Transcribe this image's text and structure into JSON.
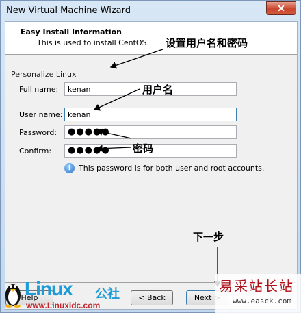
{
  "window": {
    "title": "New Virtual Machine Wizard",
    "close_glyph": "✕"
  },
  "header": {
    "title": "Easy Install Information",
    "subtitle": "This is used to install CentOS."
  },
  "group": {
    "label": "Personalize Linux"
  },
  "fields": {
    "full_name": {
      "label": "Full name:",
      "value": "kenan"
    },
    "user_name": {
      "label": "User name:",
      "value": "kenan"
    },
    "password": {
      "label": "Password:",
      "value": "●●●●●"
    },
    "confirm": {
      "label": "Confirm:",
      "value": "●●●●●"
    }
  },
  "info": {
    "icon": "info-icon",
    "text": "This password is for both user and root accounts."
  },
  "buttons": {
    "help": "Help",
    "back": "< Back",
    "next": "Next >"
  },
  "annotations": {
    "set_user_pw": "设置用户名和密码",
    "username": "用户名",
    "password": "密码",
    "next_step": "下一步"
  },
  "logo": {
    "main": "Linux",
    "cn": "公社",
    "url": "www.Linuxidc.com"
  },
  "watermark": {
    "cn": "易采站长站",
    "url": "www.easck.com"
  },
  "colors": {
    "accent": "#3c7fb1",
    "close": "#c9462c",
    "logo_blue": "#1f9bd8",
    "logo_red": "#c0262c"
  }
}
